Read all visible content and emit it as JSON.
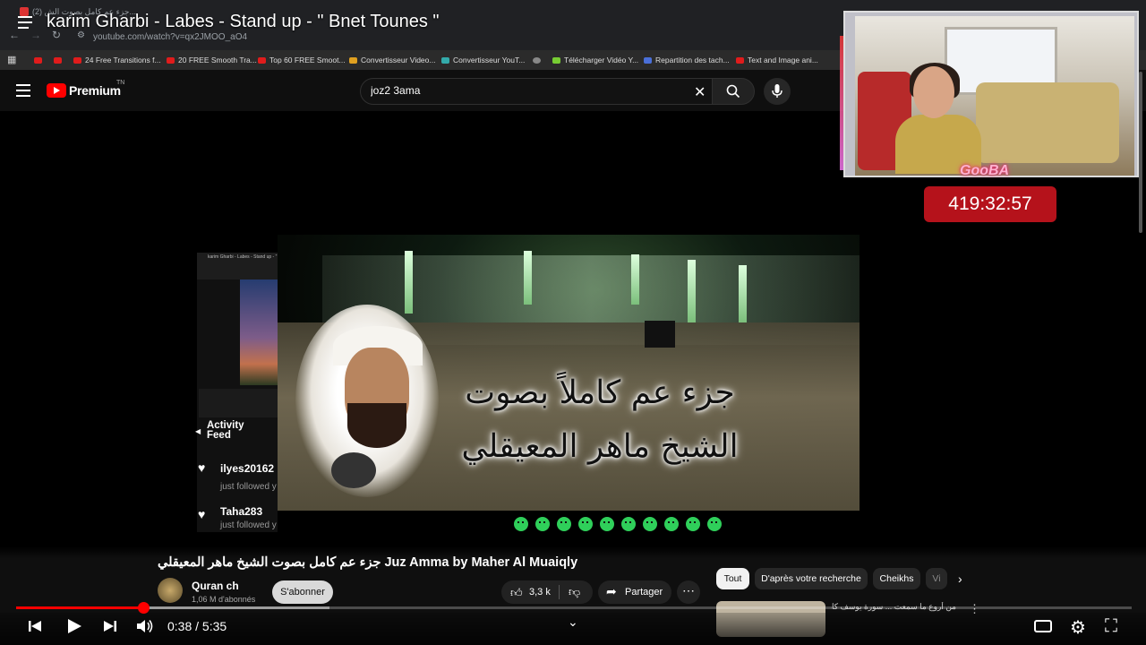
{
  "overlay": {
    "title": "karim Gharbi - Labes - Stand up - \" Bnet Tounes \""
  },
  "browser": {
    "tab_title": "(2) جزء عم كامل بصوت الش...",
    "url": "youtube.com/watch?v=qx2JMOO_aO4",
    "bookmarks": [
      "24 Free Transitions f...",
      "20 FREE Smooth Tra...",
      "Top 60 FREE Smoot...",
      "Convertisseur Video...",
      "Convertisseur YouT...",
      "Télécharger Vidéo Y...",
      "Repartition des tach...",
      "Text and Image ani..."
    ]
  },
  "youtube": {
    "brand": "Premium",
    "country": "TN",
    "search": {
      "value": "joz2 3ama"
    }
  },
  "stream": {
    "cam_logo": "GooBA",
    "timer": "419:32:57",
    "activity_feed": {
      "title": "Activity Feed",
      "items": [
        {
          "user": "ilyes20162",
          "action": "just followed y"
        },
        {
          "user": "Taha283",
          "action": "just followed y"
        }
      ]
    },
    "mini_player_title": "karim Gharbi - Labes - Stand up - \""
  },
  "video": {
    "overlay_line1": "جزء عم كاملاً بصوت",
    "overlay_line2": "الشيخ ماهر المعيقلي",
    "title": "جزء عم كامل بصوت الشيخ ماهر المعيقلي Juz Amma by Maher Al Muaiqly",
    "channel": "Quran ch",
    "subscribers": "1,06 M d'abonnés",
    "subscribe_label": "S'abonner",
    "likes": "3,3 k",
    "share_label": "Partager",
    "progress_fraction": 0.114,
    "time": "0:38 / 5:35"
  },
  "chips": [
    "Tout",
    "D'après votre recherche",
    "Cheikhs",
    "Vi"
  ],
  "related": {
    "title": "من أروع ما سمعت ... سورة يوسف كاملة"
  },
  "icons": {
    "prev": "skip-previous-icon",
    "play": "play-icon",
    "next": "skip-next-icon",
    "volume": "volume-icon",
    "settings": "gear-icon",
    "fullscreen": "exit-fullscreen-icon",
    "subtitles": "subtitles-icon",
    "like": "thumbs-up-icon",
    "dislike": "thumbs-down-icon",
    "share": "share-icon",
    "search": "search-icon",
    "mic": "mic-icon"
  },
  "colors": {
    "accent": "#ff0000",
    "timer_bg": "#b5121b",
    "emoji": "#2fcf5a"
  }
}
